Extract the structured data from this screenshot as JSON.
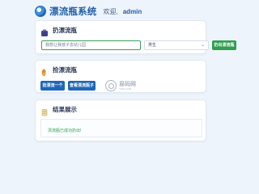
{
  "header": {
    "title": "漂流瓶系统",
    "welcome": "欢迎,",
    "username": "admin"
  },
  "throw_section": {
    "title": "扔漂流瓶",
    "input_value": "我想让我孩子去幼儿园",
    "gender_value": "男生",
    "button_label": "扔出漂流瓶"
  },
  "pick_section": {
    "title": "捡漂流瓶",
    "pick_button_label": "捡漂流一个",
    "view_button_label": "查看漂流瓶子",
    "watermark_main": "易码网",
    "watermark_sub": "YIMA.COM"
  },
  "result_section": {
    "title": "结果展示",
    "result_text": "漂流瓶已成功扔出!"
  },
  "colors": {
    "brand": "#1f5fa8",
    "primary_button": "#1e66b8",
    "success": "#2f9e4f",
    "background": "#eef4fb"
  },
  "icons": {
    "logo": "bottle-logo-icon",
    "throw": "bottle-icon",
    "pick": "hand-icon",
    "result": "scroll-icon"
  }
}
